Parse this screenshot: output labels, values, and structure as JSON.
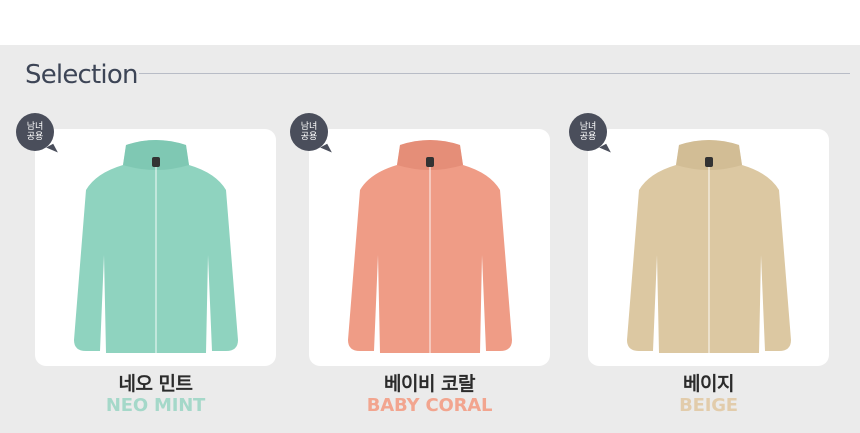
{
  "section": {
    "title": "Selection"
  },
  "products": [
    {
      "badge_line1": "남녀",
      "badge_line2": "공용",
      "name_ko": "네오 민트",
      "name_en": "NEO MINT",
      "color": "#8fd3bf",
      "shade": "#6fbea8",
      "label_color": "#a5d8c9"
    },
    {
      "badge_line1": "남녀",
      "badge_line2": "공용",
      "name_ko": "베이비 코랄",
      "name_en": "BABY CORAL",
      "color": "#ef9c86",
      "shade": "#dc7f69",
      "label_color": "#f2a58f"
    },
    {
      "badge_line1": "남녀",
      "badge_line2": "공용",
      "name_ko": "베이지",
      "name_en": "BEIGE",
      "color": "#dcc8a2",
      "shade": "#c8b187",
      "label_color": "#e2ccab"
    }
  ]
}
